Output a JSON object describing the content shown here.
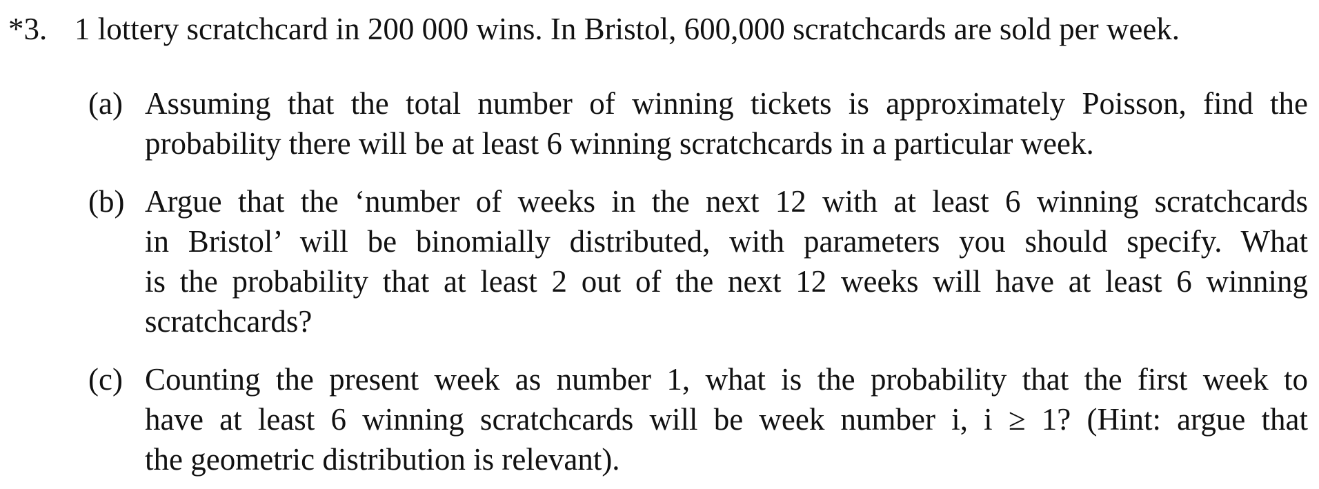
{
  "question": {
    "number": "*3.",
    "stem": "1 lottery scratchcard in 200 000 wins. In Bristol, 600,000 scratchcards are sold per week."
  },
  "parts": [
    {
      "label": "(a)",
      "lines": [
        "Assuming that the total number of winning tickets is approximately Poisson, find the",
        "probability there will be at least 6 winning scratchcards in a particular week."
      ]
    },
    {
      "label": "(b)",
      "lines": [
        "Argue that the ‘number of weeks in the next 12 with at least 6 winning scratchcards",
        "in Bristol’ will be binomially distributed, with parameters you should specify. What",
        "is the probability that at least 2 out of the next 12 weeks will have at least 6 winning",
        "scratchcards?"
      ]
    },
    {
      "label": "(c)",
      "lines": [
        "Counting the present week as number 1, what is the probability that the first week to",
        "have at least 6 winning scratchcards will be week number i, i ≥ 1? (Hint: argue that",
        "the geometric distribution is relevant)."
      ]
    }
  ]
}
